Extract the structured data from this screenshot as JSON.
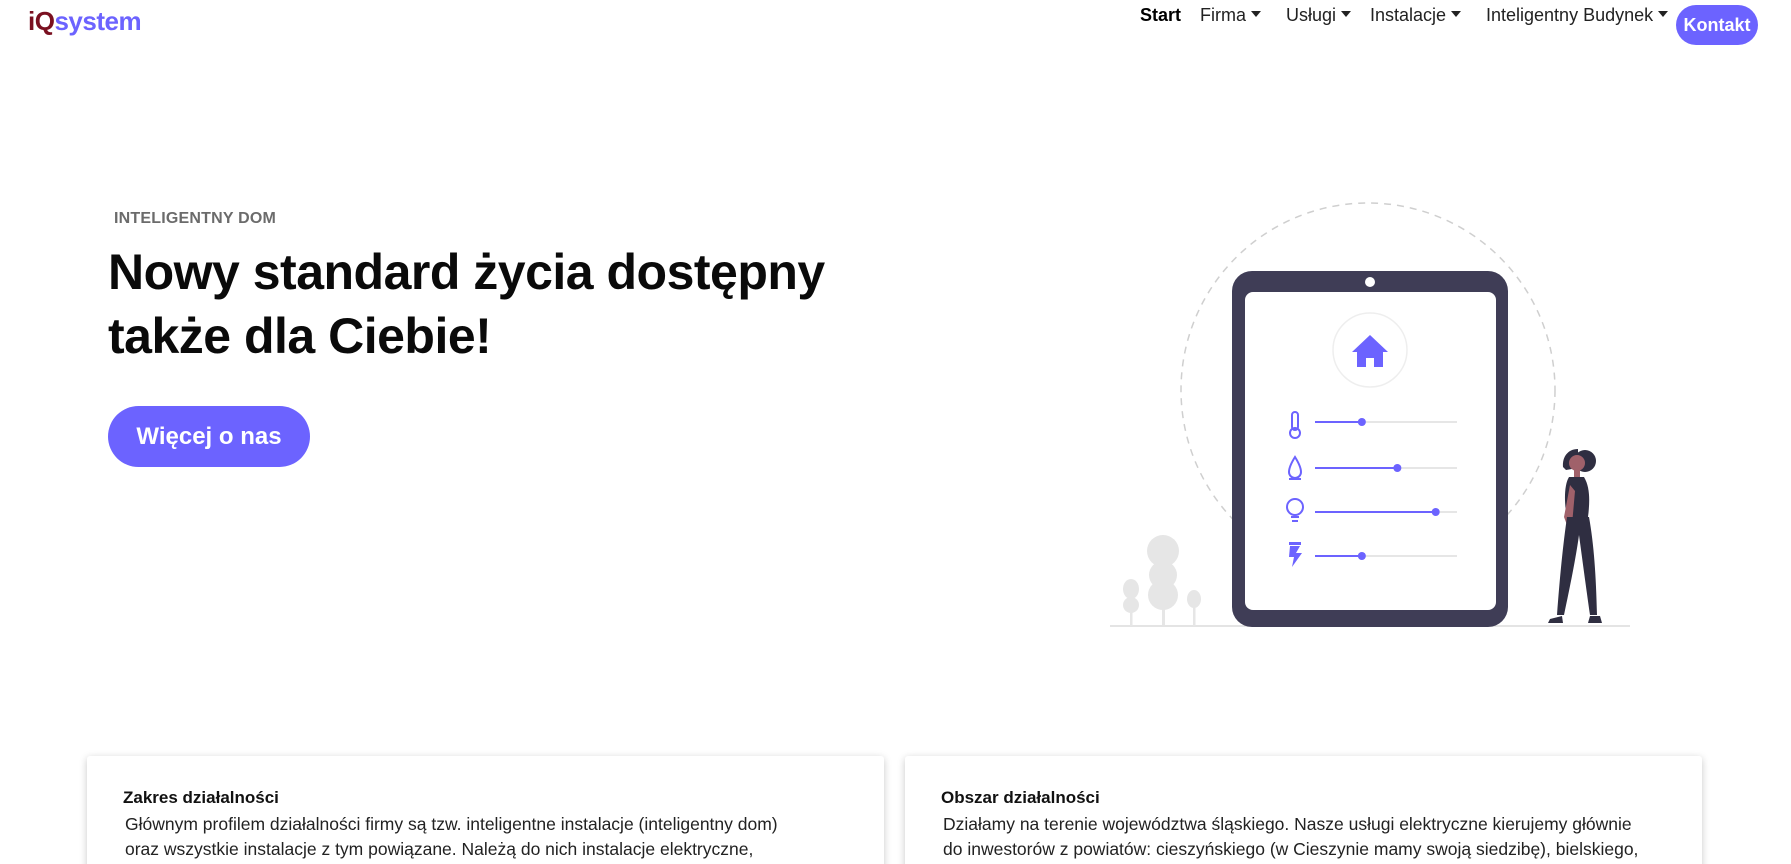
{
  "header": {
    "logo_part1": "iQ",
    "logo_part2": "system",
    "nav": [
      {
        "label": "Start",
        "active": true,
        "dropdown": false
      },
      {
        "label": "Firma",
        "active": false,
        "dropdown": true
      },
      {
        "label": "Usługi",
        "active": false,
        "dropdown": true
      },
      {
        "label": "Instalacje",
        "active": false,
        "dropdown": true
      },
      {
        "label": "Inteligentny Budynek",
        "active": false,
        "dropdown": true
      }
    ],
    "contact_label": "Kontakt"
  },
  "hero": {
    "eyebrow": "INTELIGENTNY DOM",
    "headline_line1": "Nowy standard życia dostępny",
    "headline_line2": "także dla Ciebie!",
    "cta_label": "Więcej o nas"
  },
  "illustration": {
    "icons": [
      "home-icon",
      "thermometer-icon",
      "water-drop-icon",
      "lightbulb-icon",
      "lightning-icon"
    ],
    "slider_levels": [
      0.33,
      0.58,
      0.85,
      0.33
    ],
    "accent_color": "#6c63ff",
    "device_color": "#3f3d56"
  },
  "cards": [
    {
      "title": "Zakres działalności",
      "line1": "Głównym profilem działalności firmy są tzw. inteligentne instalacje (inteligentny dom)",
      "line2": "oraz wszystkie instalacje z tym powiązane. Należą do nich instalacje elektryczne,"
    },
    {
      "title": "Obszar działalności",
      "line1": "Działamy na terenie województwa śląskiego. Nasze usługi elektryczne kierujemy głównie",
      "line2": "do inwestorów z powiatów: cieszyńskiego (w Cieszynie mamy swoją siedzibę), bielskiego,"
    }
  ],
  "colors": {
    "accent": "#6c63ff",
    "logo_dark": "#7a1020"
  }
}
